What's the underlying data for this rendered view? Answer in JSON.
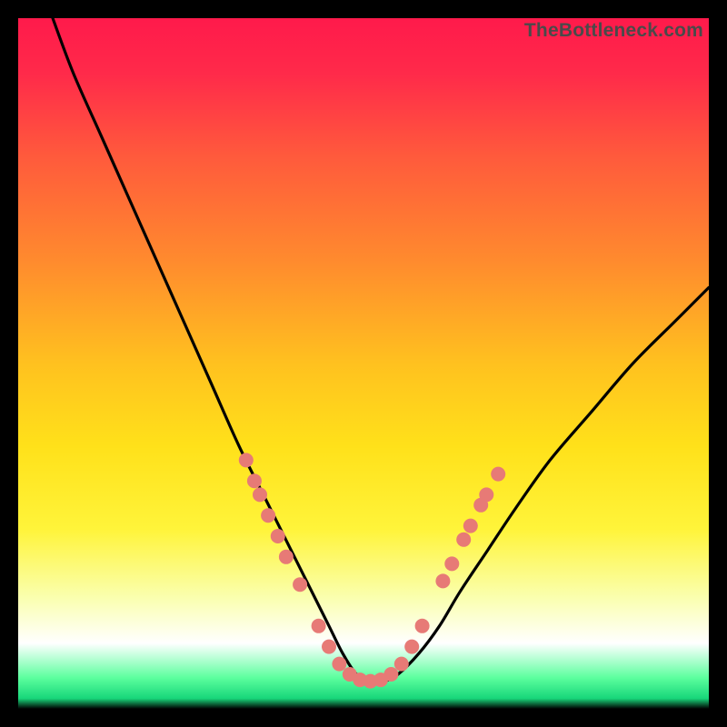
{
  "watermark": "TheBottleneck.com",
  "chart_data": {
    "type": "line",
    "title": "",
    "xlabel": "",
    "ylabel": "",
    "xlim": [
      0,
      100
    ],
    "ylim": [
      0,
      100
    ],
    "gradient_stops": [
      {
        "offset": 0.0,
        "color": "#ff1a4b"
      },
      {
        "offset": 0.08,
        "color": "#ff2a4a"
      },
      {
        "offset": 0.2,
        "color": "#ff5a3c"
      },
      {
        "offset": 0.35,
        "color": "#ff8a2e"
      },
      {
        "offset": 0.5,
        "color": "#ffc11f"
      },
      {
        "offset": 0.62,
        "color": "#ffe11a"
      },
      {
        "offset": 0.74,
        "color": "#fff43a"
      },
      {
        "offset": 0.84,
        "color": "#faffb0"
      },
      {
        "offset": 0.905,
        "color": "#ffffff"
      },
      {
        "offset": 0.955,
        "color": "#5cff9e"
      },
      {
        "offset": 0.985,
        "color": "#18d67a"
      },
      {
        "offset": 1.0,
        "color": "#000000"
      }
    ],
    "series": [
      {
        "name": "bottleneck-curve",
        "x": [
          5,
          8,
          12,
          16,
          20,
          24,
          28,
          32,
          36,
          40,
          43,
          45,
          47,
          49,
          51,
          53,
          55,
          58,
          61,
          64,
          68,
          72,
          77,
          83,
          89,
          95,
          100
        ],
        "y": [
          100,
          92,
          83,
          74,
          65,
          56,
          47,
          38,
          30,
          22,
          16,
          12,
          8,
          5,
          4,
          4,
          5,
          8,
          12,
          17,
          23,
          29,
          36,
          43,
          50,
          56,
          61
        ]
      }
    ],
    "markers": {
      "name": "highlight-points",
      "color": "#e77a76",
      "radius": 8,
      "points": [
        {
          "x": 33.0,
          "y": 36
        },
        {
          "x": 34.2,
          "y": 33
        },
        {
          "x": 35.0,
          "y": 31
        },
        {
          "x": 36.2,
          "y": 28
        },
        {
          "x": 37.6,
          "y": 25
        },
        {
          "x": 38.8,
          "y": 22
        },
        {
          "x": 40.8,
          "y": 18
        },
        {
          "x": 43.5,
          "y": 12
        },
        {
          "x": 45.0,
          "y": 9
        },
        {
          "x": 46.5,
          "y": 6.5
        },
        {
          "x": 48.0,
          "y": 5.0
        },
        {
          "x": 49.5,
          "y": 4.2
        },
        {
          "x": 51.0,
          "y": 4.0
        },
        {
          "x": 52.5,
          "y": 4.2
        },
        {
          "x": 54.0,
          "y": 5.0
        },
        {
          "x": 55.5,
          "y": 6.5
        },
        {
          "x": 57.0,
          "y": 9.0
        },
        {
          "x": 58.5,
          "y": 12.0
        },
        {
          "x": 61.5,
          "y": 18.5
        },
        {
          "x": 62.8,
          "y": 21.0
        },
        {
          "x": 64.5,
          "y": 24.5
        },
        {
          "x": 65.5,
          "y": 26.5
        },
        {
          "x": 67.0,
          "y": 29.5
        },
        {
          "x": 67.8,
          "y": 31.0
        },
        {
          "x": 69.5,
          "y": 34.0
        }
      ]
    }
  }
}
